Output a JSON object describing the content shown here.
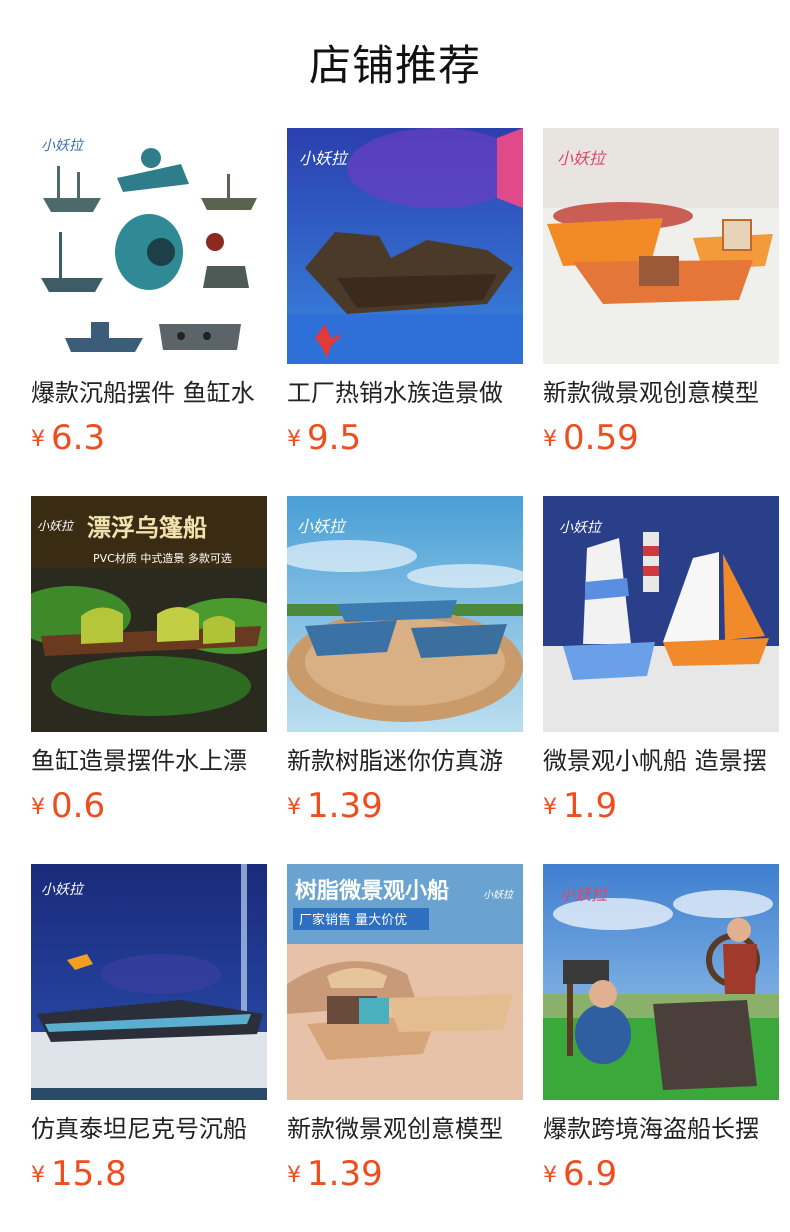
{
  "section": {
    "title": "店铺推荐"
  },
  "currency_symbol": "¥",
  "products": [
    {
      "name": "爆款沉船摆件 鱼缸水",
      "price": "6.3",
      "image": "shipwreck-ornaments-collection",
      "brand_watermark": "小妖拉"
    },
    {
      "name": "工厂热销水族造景做",
      "price": "9.5",
      "image": "pirate-ship-wreck-coral",
      "brand_watermark": "小妖拉"
    },
    {
      "name": "新款微景观创意模型",
      "price": "0.59",
      "image": "orange-mini-boats-sand",
      "brand_watermark": "小妖拉"
    },
    {
      "name": "鱼缸造景摆件水上漂",
      "price": "0.6",
      "image": "floating-wupeng-boats",
      "brand_watermark": "小妖拉",
      "banner_title": "漂浮乌篷船",
      "banner_sub": "PVC材质 中式造景 多款可选"
    },
    {
      "name": "新款树脂迷你仿真游",
      "price": "1.39",
      "image": "blue-mini-yachts-wood",
      "brand_watermark": "小妖拉"
    },
    {
      "name": "微景观小帆船 造景摆",
      "price": "1.9",
      "image": "mini-sailboats-lighthouse",
      "brand_watermark": "小妖拉"
    },
    {
      "name": "仿真泰坦尼克号沉船",
      "price": "15.8",
      "image": "titanic-wreck-aquarium",
      "brand_watermark": "小妖拉"
    },
    {
      "name": "新款微景观创意模型",
      "price": "1.39",
      "image": "resin-mini-boats-bridge",
      "brand_watermark": "小妖拉",
      "banner_title": "树脂微景观小船",
      "banner_sub": "厂家销售 量大价优"
    },
    {
      "name": "爆款跨境海盗船长摆",
      "price": "6.9",
      "image": "pirate-captain-figurine",
      "brand_watermark": "小妖拉"
    }
  ]
}
